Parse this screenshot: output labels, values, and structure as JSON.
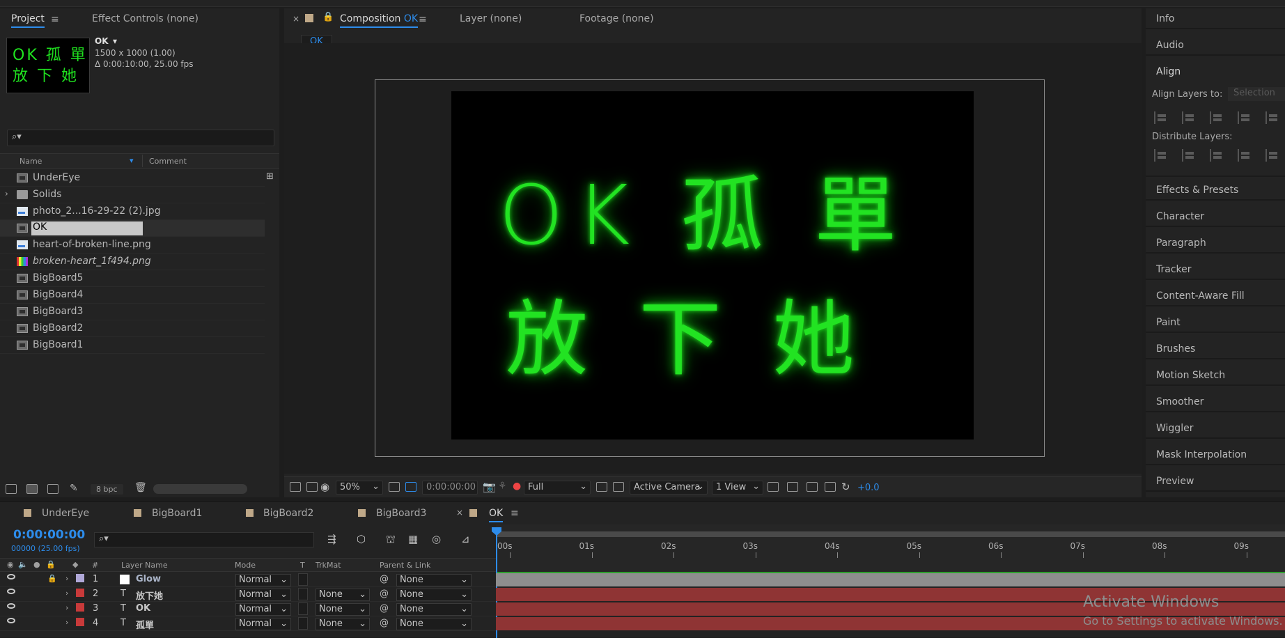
{
  "project_panel": {
    "tab_project": "Project",
    "tab_effect_controls": "Effect Controls (none)",
    "selected_comp": {
      "name": "OK",
      "size": "1500 x 1000 (1.00)",
      "duration": "Δ 0:00:10:00, 25.00 fps",
      "thumb_line1": "OK 孤 單",
      "thumb_line2": "放 下 她"
    },
    "columns": {
      "name": "Name",
      "comment": "Comment"
    },
    "items": [
      {
        "label": "UnderEye",
        "icon": "comp-icon"
      },
      {
        "label": "Solids",
        "icon": "folder-icon"
      },
      {
        "label": "photo_2...16-29-22 (2).jpg",
        "icon": "image-icon"
      },
      {
        "label": "OK",
        "icon": "comp-icon"
      },
      {
        "label": "heart-of-broken-line.png",
        "icon": "image-icon"
      },
      {
        "label": "broken-heart_1f494.png",
        "icon": "color-bars-icon"
      },
      {
        "label": "BigBoard5",
        "icon": "comp-icon"
      },
      {
        "label": "BigBoard4",
        "icon": "comp-icon"
      },
      {
        "label": "BigBoard3",
        "icon": "comp-icon"
      },
      {
        "label": "BigBoard2",
        "icon": "comp-icon"
      },
      {
        "label": "BigBoard1",
        "icon": "comp-icon"
      }
    ],
    "bpc": "8 bpc"
  },
  "viewer": {
    "tab_composition_prefix": "Composition",
    "tab_composition_name": "OK",
    "tab_layer": "Layer  (none)",
    "tab_footage": "Footage  (none)",
    "breadcrumb": "OK",
    "canvas_line1": "OK 孤 單",
    "canvas_line2": "放 下 她",
    "glow_color": "#22e322",
    "toolbar": {
      "zoom": "50%",
      "timecode": "0:00:00:00",
      "resolution": "Full",
      "camera": "Active Camera",
      "views": "1 View",
      "exposure": "+0.0"
    }
  },
  "right_panel": {
    "items": [
      "Info",
      "Audio",
      "Align",
      "Effects & Presets",
      "Character",
      "Paragraph",
      "Tracker",
      "Content-Aware Fill",
      "Paint",
      "Brushes",
      "Motion Sketch",
      "Smoother",
      "Wiggler",
      "Mask Interpolation",
      "Preview"
    ],
    "align_layers_to": "Align Layers to:",
    "align_selection": "Selection",
    "distribute_layers": "Distribute Layers:"
  },
  "timeline": {
    "tabs": [
      "UnderEye",
      "BigBoard1",
      "BigBoard2",
      "BigBoard3",
      "OK"
    ],
    "timecode": "0:00:00:00",
    "framecount": "00000 (25.00 fps)",
    "columns": {
      "num": "#",
      "layer_name": "Layer Name",
      "mode": "Mode",
      "t": "T",
      "trkmat": "TrkMat",
      "parent": "Parent & Link"
    },
    "ruler": [
      "00s",
      "01s",
      "02s",
      "03s",
      "04s",
      "05s",
      "06s",
      "07s",
      "08s",
      "09s"
    ],
    "layers": [
      {
        "num": "1",
        "type": "solid",
        "name": "Glow",
        "mode": "Normal",
        "trkmat": "",
        "parent": "None",
        "label_color": "#b0a8d8",
        "bar_color": "#8e8e8e"
      },
      {
        "num": "2",
        "type": "T",
        "name": "放下她",
        "mode": "Normal",
        "trkmat": "None",
        "parent": "None",
        "label_color": "#c83a3a",
        "bar_color": "#8f3434"
      },
      {
        "num": "3",
        "type": "T",
        "name": "OK",
        "mode": "Normal",
        "trkmat": "None",
        "parent": "None",
        "label_color": "#c83a3a",
        "bar_color": "#8f3434"
      },
      {
        "num": "4",
        "type": "T",
        "name": "孤單",
        "mode": "Normal",
        "trkmat": "None",
        "parent": "None",
        "label_color": "#c83a3a",
        "bar_color": "#8f3434"
      }
    ]
  },
  "watermark": {
    "line1": "Activate Windows",
    "line2": "Go to Settings to activate Windows."
  }
}
